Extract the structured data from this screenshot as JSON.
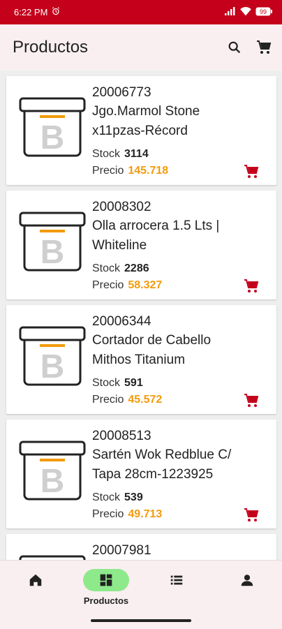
{
  "status": {
    "time": "6:22 PM",
    "battery": "99"
  },
  "app_bar": {
    "title": "Productos",
    "search_icon": "search-icon",
    "cart_icon": "cart-icon"
  },
  "labels": {
    "stock": "Stock",
    "price": "Precio"
  },
  "products": [
    {
      "code": "20006773",
      "name_line1": "Jgo.Marmol Stone",
      "name_line2": "x11pzas-Récord",
      "stock": "3114",
      "price": "145.718"
    },
    {
      "code": "20008302",
      "name_line1": "Olla arrocera 1.5 Lts |",
      "name_line2": "Whiteline",
      "stock": "2286",
      "price": "58.327"
    },
    {
      "code": "20006344",
      "name_line1": "Cortador de Cabello",
      "name_line2": "Mithos Titanium",
      "stock": "591",
      "price": "45.572"
    },
    {
      "code": "20008513",
      "name_line1": "Sartén Wok  Redblue C/",
      "name_line2": "Tapa 28cm-1223925",
      "stock": "539",
      "price": "49.713"
    },
    {
      "code": "20007981",
      "name_line1": "",
      "name_line2": "",
      "stock": "",
      "price": ""
    }
  ],
  "bottom_nav": [
    {
      "id": "home",
      "label": "",
      "icon": "home-icon",
      "active": false
    },
    {
      "id": "productos",
      "label": "Productos",
      "icon": "grid-icon",
      "active": true
    },
    {
      "id": "list",
      "label": "",
      "icon": "list-icon",
      "active": false
    },
    {
      "id": "profile",
      "label": "",
      "icon": "person-icon",
      "active": false
    }
  ],
  "colors": {
    "status_bar": "#c4001a",
    "accent_price": "#f29b0c",
    "cart_red": "#c4001a",
    "nav_active": "#8ee98a"
  }
}
